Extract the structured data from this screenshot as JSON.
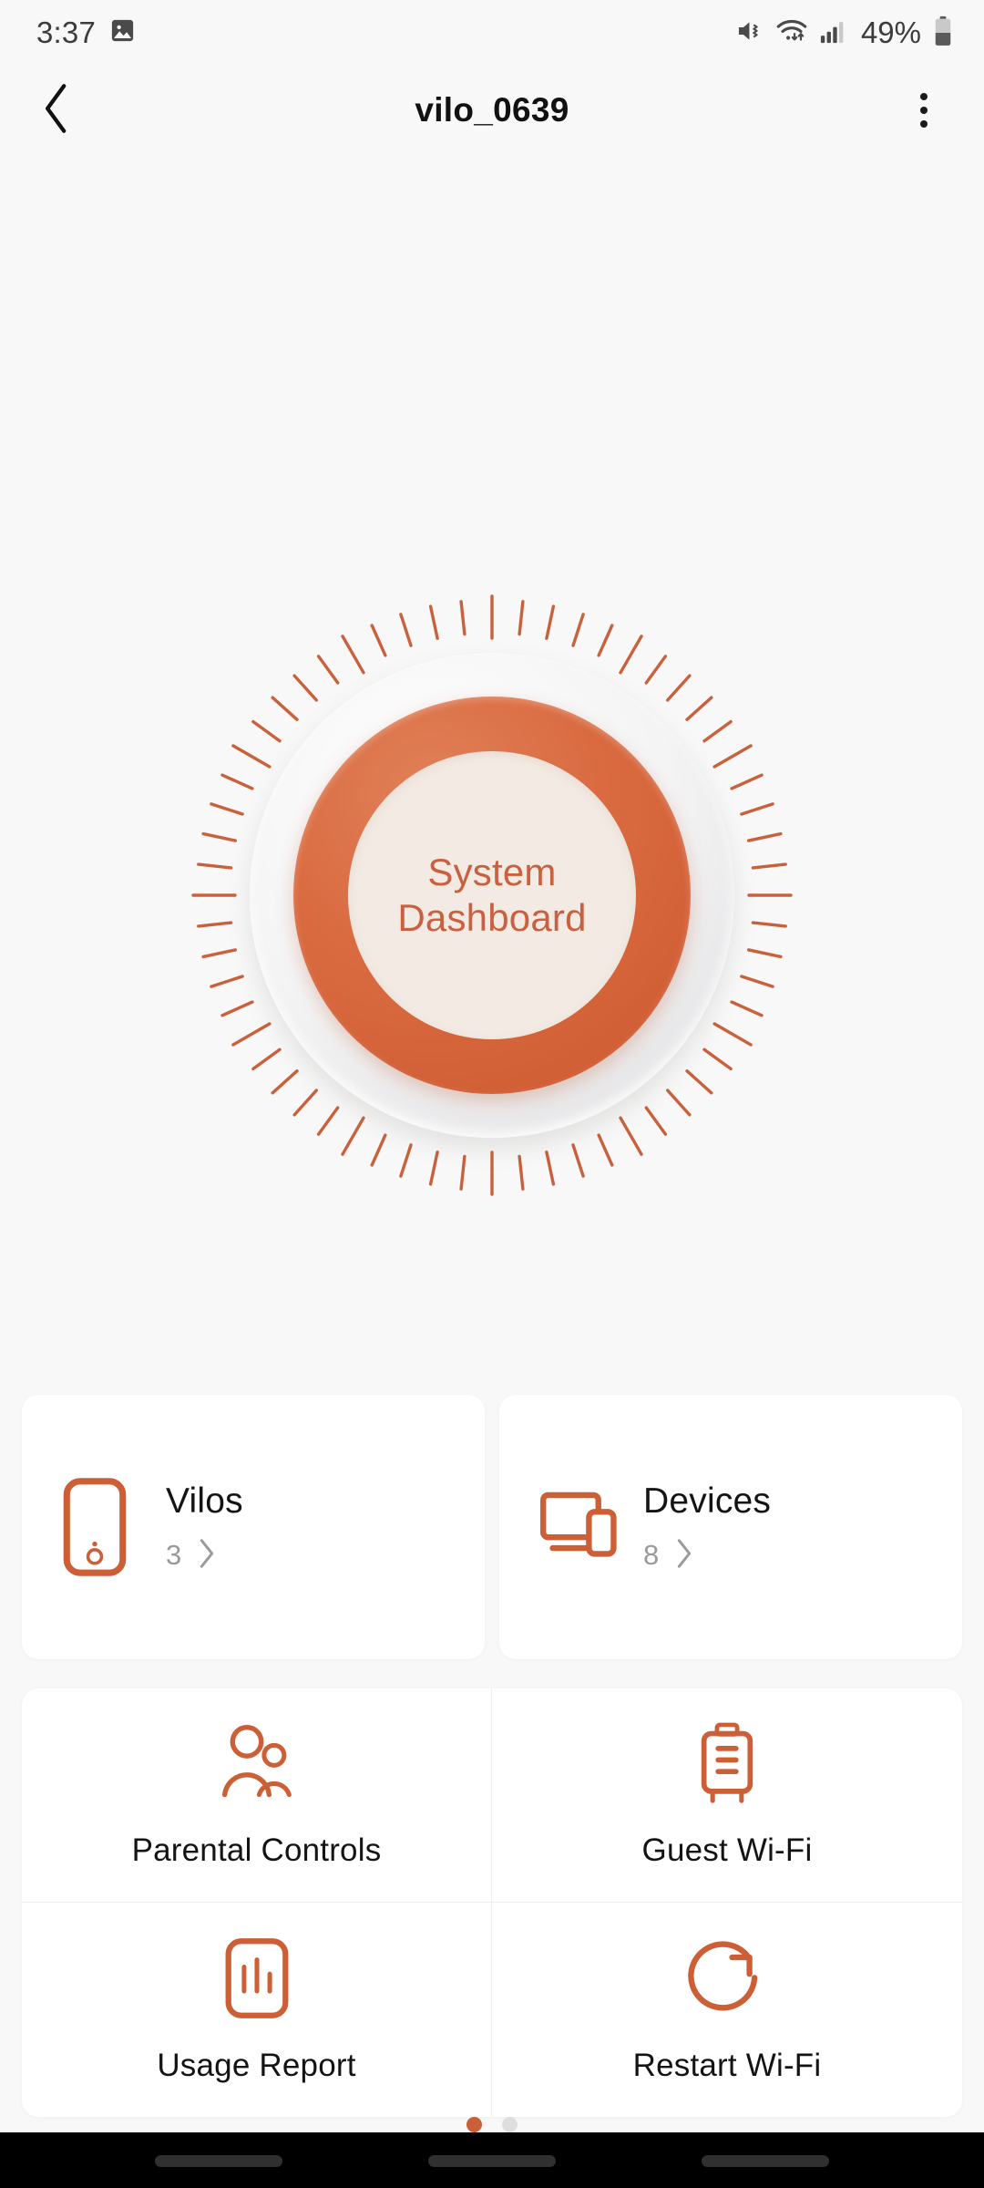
{
  "status_bar": {
    "time": "3:37",
    "battery_percent": "49%",
    "icons": [
      "image-icon",
      "mute-vibrate-icon",
      "wifi-icon",
      "cellular-signal-icon",
      "battery-icon"
    ]
  },
  "header": {
    "back_label": "‹",
    "title": "vilo_0639",
    "menu_label": "overflow-menu"
  },
  "hero": {
    "dial_line1": "System",
    "dial_line2": "Dashboard",
    "tick_count": 60
  },
  "summary_cards": [
    {
      "icon": "vilo-node-icon",
      "title": "Vilos",
      "count": "3",
      "chevron": "›"
    },
    {
      "icon": "devices-icon",
      "title": "Devices",
      "count": "8",
      "chevron": "›"
    }
  ],
  "quick_actions": [
    {
      "icon": "parental-controls-icon",
      "label": "Parental Controls"
    },
    {
      "icon": "guest-wifi-icon",
      "label": "Guest Wi-Fi"
    },
    {
      "icon": "usage-report-icon",
      "label": "Usage Report"
    },
    {
      "icon": "restart-wifi-icon",
      "label": "Restart Wi-Fi"
    }
  ],
  "pagination": {
    "total": 2,
    "active_index": 0,
    "active_color": "#cc5f36",
    "inactive_color": "#dedede"
  },
  "nav_bar": {
    "buttons": [
      "recents-button",
      "home-button",
      "back-button"
    ]
  },
  "theme": {
    "accent": "#cc5f36",
    "dial_ring": "#d9633c",
    "dial_inner_bg": "#f2eae3",
    "dial_text": "#c9603f",
    "page_bg": "#f8f8f8",
    "card_bg": "#ffffff",
    "muted_text": "#9a9a9a",
    "primary_text": "#141414"
  }
}
